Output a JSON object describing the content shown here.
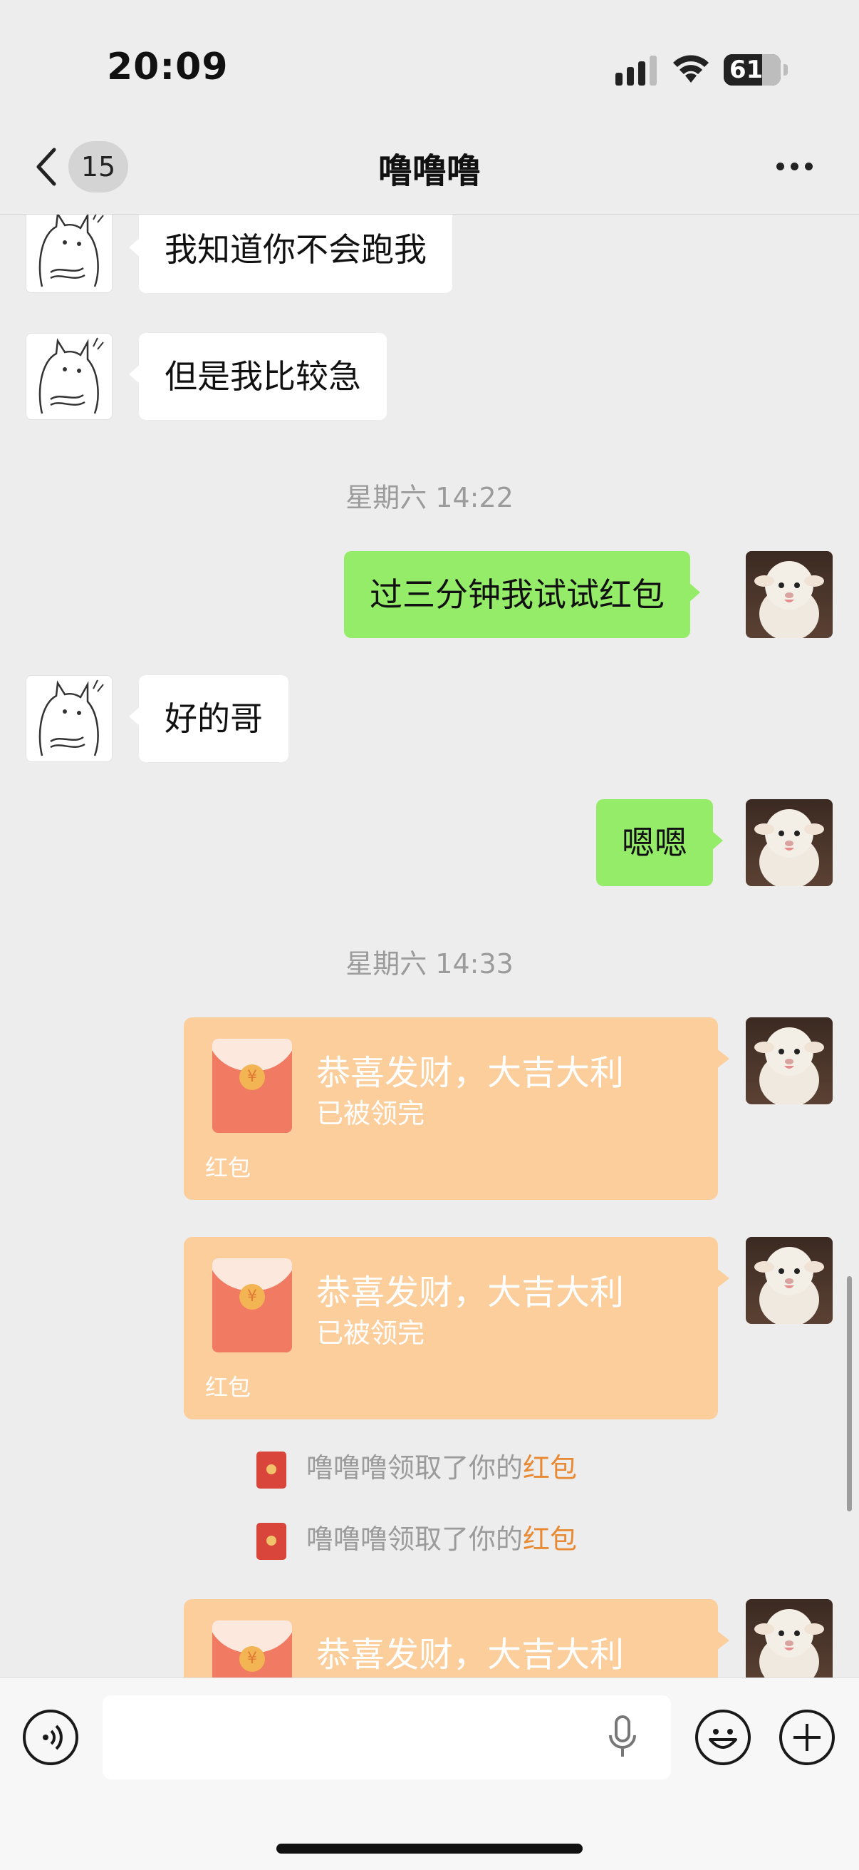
{
  "status": {
    "time": "20:09",
    "battery": "61",
    "battery_level": 0.61
  },
  "nav": {
    "back_count": "15",
    "title": "噜噜噜"
  },
  "messages": [
    {
      "text": "我知道你不会跑我"
    },
    {
      "text": "但是我比较急"
    },
    {
      "timestamp": "星期六 14:22"
    },
    {
      "text": "过三分钟我试试红包"
    },
    {
      "text": "好的哥"
    },
    {
      "text": "嗯嗯"
    },
    {
      "timestamp": "星期六 14:33"
    }
  ],
  "red_packets": [
    {
      "title": "恭喜发财，大吉大利",
      "status": "已被领完",
      "label": "红包",
      "coin": "¥"
    },
    {
      "title": "恭喜发财，大吉大利",
      "status": "已被领完",
      "label": "红包",
      "coin": "¥"
    },
    {
      "title": "恭喜发财，大吉大利",
      "coin": "¥"
    }
  ],
  "system": [
    {
      "prefix": "噜噜噜领取了你的",
      "link": "红包"
    },
    {
      "prefix": "噜噜噜领取了你的",
      "link": "红包"
    }
  ],
  "colors": {
    "background": "#ededed",
    "outgoing": "#95ec69",
    "incoming": "#ffffff",
    "red_packet": "#fcce9c",
    "link": "#e88a34"
  },
  "input": {
    "placeholder": ""
  }
}
